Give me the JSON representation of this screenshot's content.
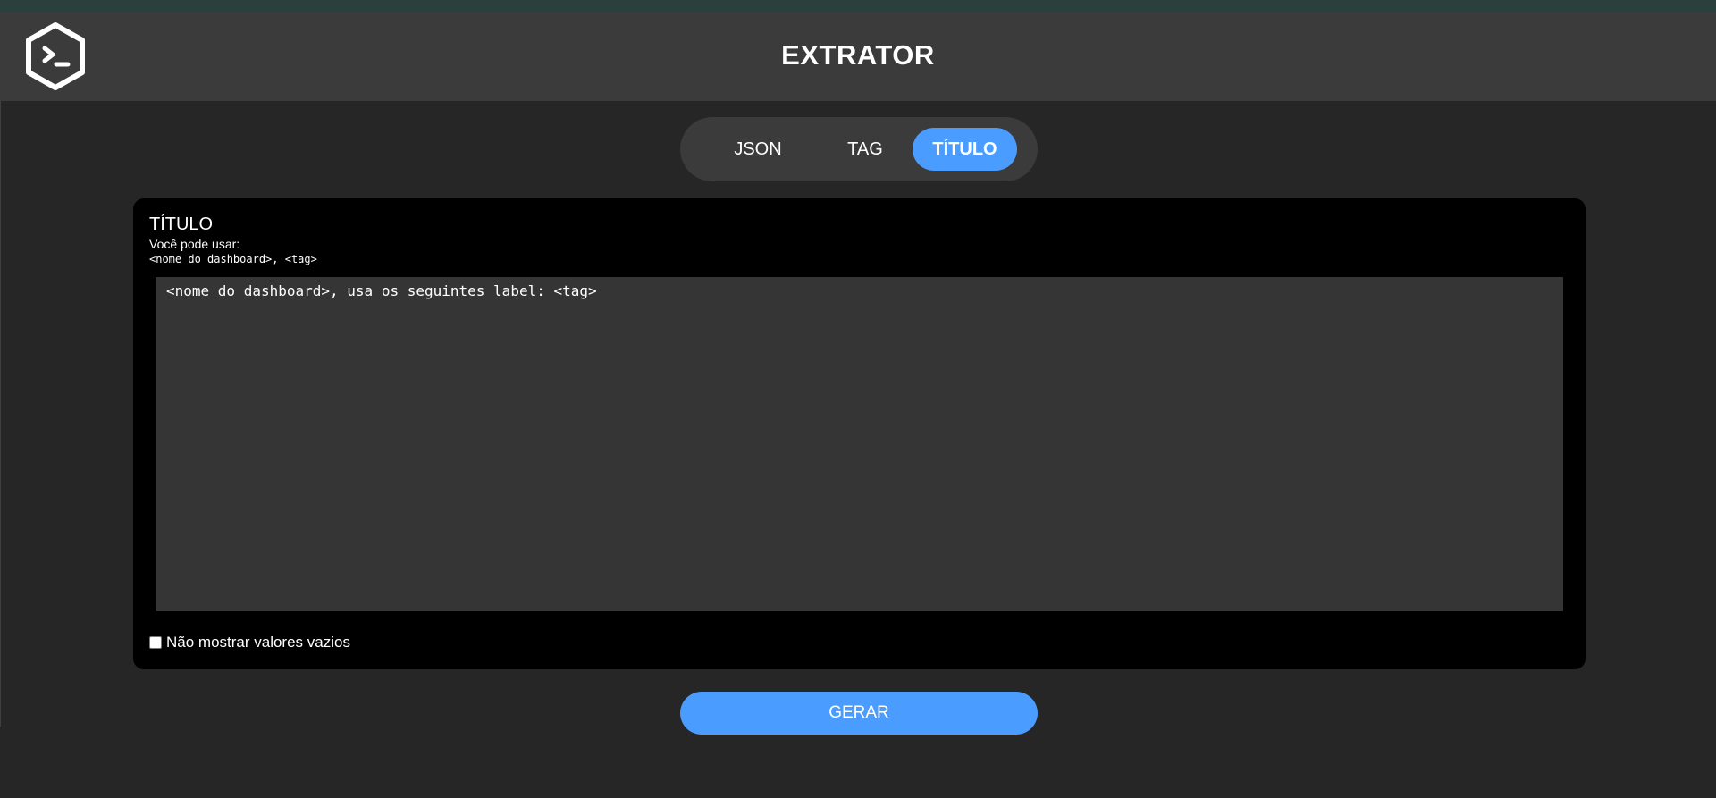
{
  "header": {
    "title": "EXTRATOR",
    "logo_icon": "terminal-hexagon-icon"
  },
  "tabs": [
    {
      "label": "JSON",
      "active": false
    },
    {
      "label": "TAG",
      "active": false
    },
    {
      "label": "TÍTULO",
      "active": true
    }
  ],
  "panel": {
    "title": "TÍTULO",
    "hint": "Você pode usar:",
    "variables": "<nome do dashboard>, <tag>",
    "template_value": "<nome do dashboard>, usa os seguintes label: <tag>",
    "hide_empty_label": "Não mostrar valores vazios",
    "hide_empty_checked": false
  },
  "actions": {
    "generate_label": "GERAR"
  },
  "colors": {
    "accent": "#4a9dff",
    "header_bg": "#3b3b3b",
    "page_bg": "#262626",
    "panel_bg": "#000000",
    "textarea_bg": "#353535"
  }
}
